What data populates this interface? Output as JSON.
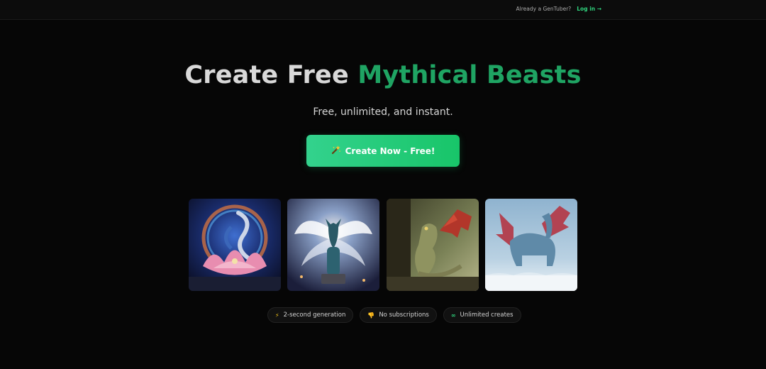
{
  "topbar": {
    "already_text": "Already a GenTuber?",
    "login_label": "Log in →"
  },
  "hero": {
    "title_white": "Create Free",
    "title_green": "Mythical Beasts",
    "subtitle": "Free, unlimited, and instant."
  },
  "cta": {
    "icon": "magic-wand-icon",
    "label": "Create Now - Free!"
  },
  "gallery": {
    "images": [
      "dragon-lotus-cosmic",
      "white-winged-wolf",
      "red-winged-dragon-rock",
      "blue-dragon-snow"
    ]
  },
  "features": [
    {
      "icon": "lightning-icon",
      "glyph": "⚡",
      "label": "2-second generation"
    },
    {
      "icon": "thumbs-down-icon",
      "glyph": "👎",
      "label": "No subscriptions"
    },
    {
      "icon": "infinity-icon",
      "glyph": "∞",
      "label": "Unlimited creates"
    }
  ],
  "colors": {
    "accent": "#1fa463",
    "cta_start": "#33d28d",
    "cta_end": "#18c569",
    "background": "#060606"
  }
}
